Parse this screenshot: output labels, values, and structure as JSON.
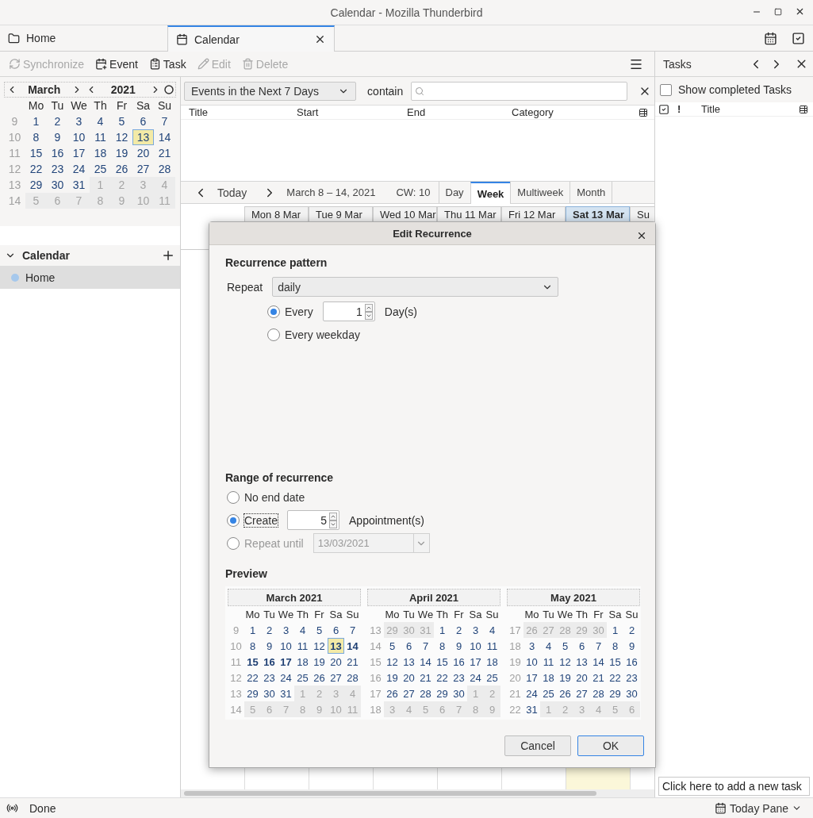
{
  "window": {
    "title": "Calendar - Mozilla Thunderbird"
  },
  "tabs": [
    {
      "label": "Home",
      "kind": "folder",
      "selected": false
    },
    {
      "label": "Calendar",
      "kind": "calendar",
      "selected": true
    }
  ],
  "toolbar": [
    {
      "label": "Synchronize",
      "kind": "sync",
      "disabled": true
    },
    {
      "label": "Event",
      "kind": "event",
      "disabled": false
    },
    {
      "label": "Task",
      "kind": "task",
      "disabled": false
    },
    {
      "label": "Edit",
      "kind": "edit",
      "disabled": true
    },
    {
      "label": "Delete",
      "kind": "delete",
      "disabled": true
    }
  ],
  "minical": {
    "month": "March",
    "year": "2021",
    "weekdays": [
      "Mo",
      "Tu",
      "We",
      "Th",
      "Fr",
      "Sa",
      "Su"
    ],
    "weeks": [
      {
        "number": "9",
        "days": [
          {
            "day": "1",
            "kind": "day"
          },
          {
            "day": "2",
            "kind": "day"
          },
          {
            "day": "3",
            "kind": "day"
          },
          {
            "day": "4",
            "kind": "day"
          },
          {
            "day": "5",
            "kind": "day"
          },
          {
            "day": "6",
            "kind": "day"
          },
          {
            "day": "7",
            "kind": "day"
          }
        ]
      },
      {
        "number": "10",
        "days": [
          {
            "day": "8",
            "kind": "day"
          },
          {
            "day": "9",
            "kind": "day"
          },
          {
            "day": "10",
            "kind": "day"
          },
          {
            "day": "11",
            "kind": "day"
          },
          {
            "day": "12",
            "kind": "day"
          },
          {
            "day": "13",
            "kind": "today"
          },
          {
            "day": "14",
            "kind": "day"
          }
        ]
      },
      {
        "number": "11",
        "days": [
          {
            "day": "15",
            "kind": "day"
          },
          {
            "day": "16",
            "kind": "day"
          },
          {
            "day": "17",
            "kind": "day"
          },
          {
            "day": "18",
            "kind": "day"
          },
          {
            "day": "19",
            "kind": "day"
          },
          {
            "day": "20",
            "kind": "day"
          },
          {
            "day": "21",
            "kind": "day"
          }
        ]
      },
      {
        "number": "12",
        "days": [
          {
            "day": "22",
            "kind": "day"
          },
          {
            "day": "23",
            "kind": "day"
          },
          {
            "day": "24",
            "kind": "day"
          },
          {
            "day": "25",
            "kind": "day"
          },
          {
            "day": "26",
            "kind": "day"
          },
          {
            "day": "27",
            "kind": "day"
          },
          {
            "day": "28",
            "kind": "day"
          }
        ]
      },
      {
        "number": "13",
        "days": [
          {
            "day": "29",
            "kind": "day"
          },
          {
            "day": "30",
            "kind": "day"
          },
          {
            "day": "31",
            "kind": "day"
          },
          {
            "day": "1",
            "kind": "outside"
          },
          {
            "day": "2",
            "kind": "outside"
          },
          {
            "day": "3",
            "kind": "outside"
          },
          {
            "day": "4",
            "kind": "outside"
          }
        ]
      },
      {
        "number": "14",
        "days": [
          {
            "day": "5",
            "kind": "outside"
          },
          {
            "day": "6",
            "kind": "outside"
          },
          {
            "day": "7",
            "kind": "outside"
          },
          {
            "day": "8",
            "kind": "outside"
          },
          {
            "day": "9",
            "kind": "outside"
          },
          {
            "day": "10",
            "kind": "outside"
          },
          {
            "day": "11",
            "kind": "outside"
          }
        ]
      }
    ]
  },
  "calendar_list": {
    "title": "Calendar",
    "items": [
      {
        "name": "Home",
        "selected": true,
        "color": "#a6c8ec"
      }
    ]
  },
  "filter": {
    "selection": "Events in the Next 7 Days",
    "label": "contain"
  },
  "event_list": {
    "columns": [
      "Title",
      "Start",
      "End",
      "Category"
    ]
  },
  "nav": {
    "today": "Today",
    "range": "March 8 – 14, 2021",
    "week": "CW: 10",
    "views": [
      {
        "label": "Day",
        "selected": false
      },
      {
        "label": "Week",
        "selected": true
      },
      {
        "label": "Multiweek",
        "selected": false
      },
      {
        "label": "Month",
        "selected": false
      }
    ]
  },
  "day_headers": [
    {
      "label": "Mon 8 Mar",
      "selected": false
    },
    {
      "label": "Tue 9 Mar",
      "selected": false
    },
    {
      "label": "Wed 10 Mar",
      "selected": false
    },
    {
      "label": "Thu 11 Mar",
      "selected": false
    },
    {
      "label": "Fri 12 Mar",
      "selected": false
    },
    {
      "label": "Sat 13 Mar",
      "selected": true
    },
    {
      "label": "Su",
      "selected": false
    }
  ],
  "tasks": {
    "title": "Tasks",
    "show_completed": {
      "label": "Show completed Tasks",
      "checked": false
    },
    "columns": [
      "!",
      "Title"
    ],
    "new_task": {
      "placeholder": "Click here to add a new task"
    }
  },
  "status": {
    "text": "Done",
    "today_pane": "Today Pane"
  },
  "dialog": {
    "title": "Edit Recurrence",
    "pattern": {
      "heading": "Recurrence pattern",
      "repeat_label": "Repeat",
      "repeat": "daily",
      "options": [
        {
          "kind": "count",
          "label": "Every",
          "value": "1",
          "unit": "Day(s)",
          "selected": true
        },
        {
          "kind": "plain",
          "label": "Every weekday",
          "selected": false
        }
      ]
    },
    "range": {
      "heading": "Range of recurrence",
      "options": [
        {
          "kind": "plain",
          "label": "No end date",
          "selected": false,
          "focused": false,
          "disabled": false
        },
        {
          "kind": "count",
          "label": "Create",
          "value": "5",
          "unit": "Appointment(s)",
          "selected": true,
          "focused": true,
          "disabled": false
        },
        {
          "kind": "date",
          "label": "Repeat until",
          "value": "13/03/2021",
          "selected": false,
          "focused": false,
          "disabled": true
        }
      ]
    },
    "preview": {
      "heading": "Preview",
      "months": [
        {
          "title": "March 2021",
          "weekdays": [
            "Mo",
            "Tu",
            "We",
            "Th",
            "Fr",
            "Sa",
            "Su"
          ],
          "weeks": [
            {
              "number": "9",
              "days": [
                {
                  "day": "1",
                  "kind": "day"
                },
                {
                  "day": "2",
                  "kind": "day"
                },
                {
                  "day": "3",
                  "kind": "day"
                },
                {
                  "day": "4",
                  "kind": "day"
                },
                {
                  "day": "5",
                  "kind": "day"
                },
                {
                  "day": "6",
                  "kind": "day"
                },
                {
                  "day": "7",
                  "kind": "day"
                }
              ]
            },
            {
              "number": "10",
              "days": [
                {
                  "day": "8",
                  "kind": "day"
                },
                {
                  "day": "9",
                  "kind": "day"
                },
                {
                  "day": "10",
                  "kind": "day"
                },
                {
                  "day": "11",
                  "kind": "day"
                },
                {
                  "day": "12",
                  "kind": "day"
                },
                {
                  "day": "13",
                  "kind": "todayhit"
                },
                {
                  "day": "14",
                  "kind": "hit"
                }
              ]
            },
            {
              "number": "11",
              "days": [
                {
                  "day": "15",
                  "kind": "hit"
                },
                {
                  "day": "16",
                  "kind": "hit"
                },
                {
                  "day": "17",
                  "kind": "hit"
                },
                {
                  "day": "18",
                  "kind": "day"
                },
                {
                  "day": "19",
                  "kind": "day"
                },
                {
                  "day": "20",
                  "kind": "day"
                },
                {
                  "day": "21",
                  "kind": "day"
                }
              ]
            },
            {
              "number": "12",
              "days": [
                {
                  "day": "22",
                  "kind": "day"
                },
                {
                  "day": "23",
                  "kind": "day"
                },
                {
                  "day": "24",
                  "kind": "day"
                },
                {
                  "day": "25",
                  "kind": "day"
                },
                {
                  "day": "26",
                  "kind": "day"
                },
                {
                  "day": "27",
                  "kind": "day"
                },
                {
                  "day": "28",
                  "kind": "day"
                }
              ]
            },
            {
              "number": "13",
              "days": [
                {
                  "day": "29",
                  "kind": "day"
                },
                {
                  "day": "30",
                  "kind": "day"
                },
                {
                  "day": "31",
                  "kind": "day"
                },
                {
                  "day": "1",
                  "kind": "outside"
                },
                {
                  "day": "2",
                  "kind": "outside"
                },
                {
                  "day": "3",
                  "kind": "outside"
                },
                {
                  "day": "4",
                  "kind": "outside"
                }
              ]
            },
            {
              "number": "14",
              "days": [
                {
                  "day": "5",
                  "kind": "outside"
                },
                {
                  "day": "6",
                  "kind": "outside"
                },
                {
                  "day": "7",
                  "kind": "outside"
                },
                {
                  "day": "8",
                  "kind": "outside"
                },
                {
                  "day": "9",
                  "kind": "outside"
                },
                {
                  "day": "10",
                  "kind": "outside"
                },
                {
                  "day": "11",
                  "kind": "outside"
                }
              ]
            }
          ]
        },
        {
          "title": "April 2021",
          "weekdays": [
            "Mo",
            "Tu",
            "We",
            "Th",
            "Fr",
            "Sa",
            "Su"
          ],
          "weeks": [
            {
              "number": "13",
              "days": [
                {
                  "day": "29",
                  "kind": "outside"
                },
                {
                  "day": "30",
                  "kind": "outside"
                },
                {
                  "day": "31",
                  "kind": "outside"
                },
                {
                  "day": "1",
                  "kind": "day"
                },
                {
                  "day": "2",
                  "kind": "day"
                },
                {
                  "day": "3",
                  "kind": "day"
                },
                {
                  "day": "4",
                  "kind": "day"
                }
              ]
            },
            {
              "number": "14",
              "days": [
                {
                  "day": "5",
                  "kind": "day"
                },
                {
                  "day": "6",
                  "kind": "day"
                },
                {
                  "day": "7",
                  "kind": "day"
                },
                {
                  "day": "8",
                  "kind": "day"
                },
                {
                  "day": "9",
                  "kind": "day"
                },
                {
                  "day": "10",
                  "kind": "day"
                },
                {
                  "day": "11",
                  "kind": "day"
                }
              ]
            },
            {
              "number": "15",
              "days": [
                {
                  "day": "12",
                  "kind": "day"
                },
                {
                  "day": "13",
                  "kind": "day"
                },
                {
                  "day": "14",
                  "kind": "day"
                },
                {
                  "day": "15",
                  "kind": "day"
                },
                {
                  "day": "16",
                  "kind": "day"
                },
                {
                  "day": "17",
                  "kind": "day"
                },
                {
                  "day": "18",
                  "kind": "day"
                }
              ]
            },
            {
              "number": "16",
              "days": [
                {
                  "day": "19",
                  "kind": "day"
                },
                {
                  "day": "20",
                  "kind": "day"
                },
                {
                  "day": "21",
                  "kind": "day"
                },
                {
                  "day": "22",
                  "kind": "day"
                },
                {
                  "day": "23",
                  "kind": "day"
                },
                {
                  "day": "24",
                  "kind": "day"
                },
                {
                  "day": "25",
                  "kind": "day"
                }
              ]
            },
            {
              "number": "17",
              "days": [
                {
                  "day": "26",
                  "kind": "day"
                },
                {
                  "day": "27",
                  "kind": "day"
                },
                {
                  "day": "28",
                  "kind": "day"
                },
                {
                  "day": "29",
                  "kind": "day"
                },
                {
                  "day": "30",
                  "kind": "day"
                },
                {
                  "day": "1",
                  "kind": "outside"
                },
                {
                  "day": "2",
                  "kind": "outside"
                }
              ]
            },
            {
              "number": "18",
              "days": [
                {
                  "day": "3",
                  "kind": "outside"
                },
                {
                  "day": "4",
                  "kind": "outside"
                },
                {
                  "day": "5",
                  "kind": "outside"
                },
                {
                  "day": "6",
                  "kind": "outside"
                },
                {
                  "day": "7",
                  "kind": "outside"
                },
                {
                  "day": "8",
                  "kind": "outside"
                },
                {
                  "day": "9",
                  "kind": "outside"
                }
              ]
            }
          ]
        },
        {
          "title": "May 2021",
          "weekdays": [
            "Mo",
            "Tu",
            "We",
            "Th",
            "Fr",
            "Sa",
            "Su"
          ],
          "weeks": [
            {
              "number": "17",
              "days": [
                {
                  "day": "26",
                  "kind": "outside"
                },
                {
                  "day": "27",
                  "kind": "outside"
                },
                {
                  "day": "28",
                  "kind": "outside"
                },
                {
                  "day": "29",
                  "kind": "outside"
                },
                {
                  "day": "30",
                  "kind": "outside"
                },
                {
                  "day": "1",
                  "kind": "day"
                },
                {
                  "day": "2",
                  "kind": "day"
                }
              ]
            },
            {
              "number": "18",
              "days": [
                {
                  "day": "3",
                  "kind": "day"
                },
                {
                  "day": "4",
                  "kind": "day"
                },
                {
                  "day": "5",
                  "kind": "day"
                },
                {
                  "day": "6",
                  "kind": "day"
                },
                {
                  "day": "7",
                  "kind": "day"
                },
                {
                  "day": "8",
                  "kind": "day"
                },
                {
                  "day": "9",
                  "kind": "day"
                }
              ]
            },
            {
              "number": "19",
              "days": [
                {
                  "day": "10",
                  "kind": "day"
                },
                {
                  "day": "11",
                  "kind": "day"
                },
                {
                  "day": "12",
                  "kind": "day"
                },
                {
                  "day": "13",
                  "kind": "day"
                },
                {
                  "day": "14",
                  "kind": "day"
                },
                {
                  "day": "15",
                  "kind": "day"
                },
                {
                  "day": "16",
                  "kind": "day"
                }
              ]
            },
            {
              "number": "20",
              "days": [
                {
                  "day": "17",
                  "kind": "day"
                },
                {
                  "day": "18",
                  "kind": "day"
                },
                {
                  "day": "19",
                  "kind": "day"
                },
                {
                  "day": "20",
                  "kind": "day"
                },
                {
                  "day": "21",
                  "kind": "day"
                },
                {
                  "day": "22",
                  "kind": "day"
                },
                {
                  "day": "23",
                  "kind": "day"
                }
              ]
            },
            {
              "number": "21",
              "days": [
                {
                  "day": "24",
                  "kind": "day"
                },
                {
                  "day": "25",
                  "kind": "day"
                },
                {
                  "day": "26",
                  "kind": "day"
                },
                {
                  "day": "27",
                  "kind": "day"
                },
                {
                  "day": "28",
                  "kind": "day"
                },
                {
                  "day": "29",
                  "kind": "day"
                },
                {
                  "day": "30",
                  "kind": "day"
                }
              ]
            },
            {
              "number": "22",
              "days": [
                {
                  "day": "31",
                  "kind": "day"
                },
                {
                  "day": "1",
                  "kind": "outside"
                },
                {
                  "day": "2",
                  "kind": "outside"
                },
                {
                  "day": "3",
                  "kind": "outside"
                },
                {
                  "day": "4",
                  "kind": "outside"
                },
                {
                  "day": "5",
                  "kind": "outside"
                },
                {
                  "day": "6",
                  "kind": "outside"
                }
              ]
            }
          ]
        }
      ]
    },
    "buttons": [
      {
        "label": "Cancel",
        "default": false
      },
      {
        "label": "OK",
        "default": true
      }
    ]
  }
}
